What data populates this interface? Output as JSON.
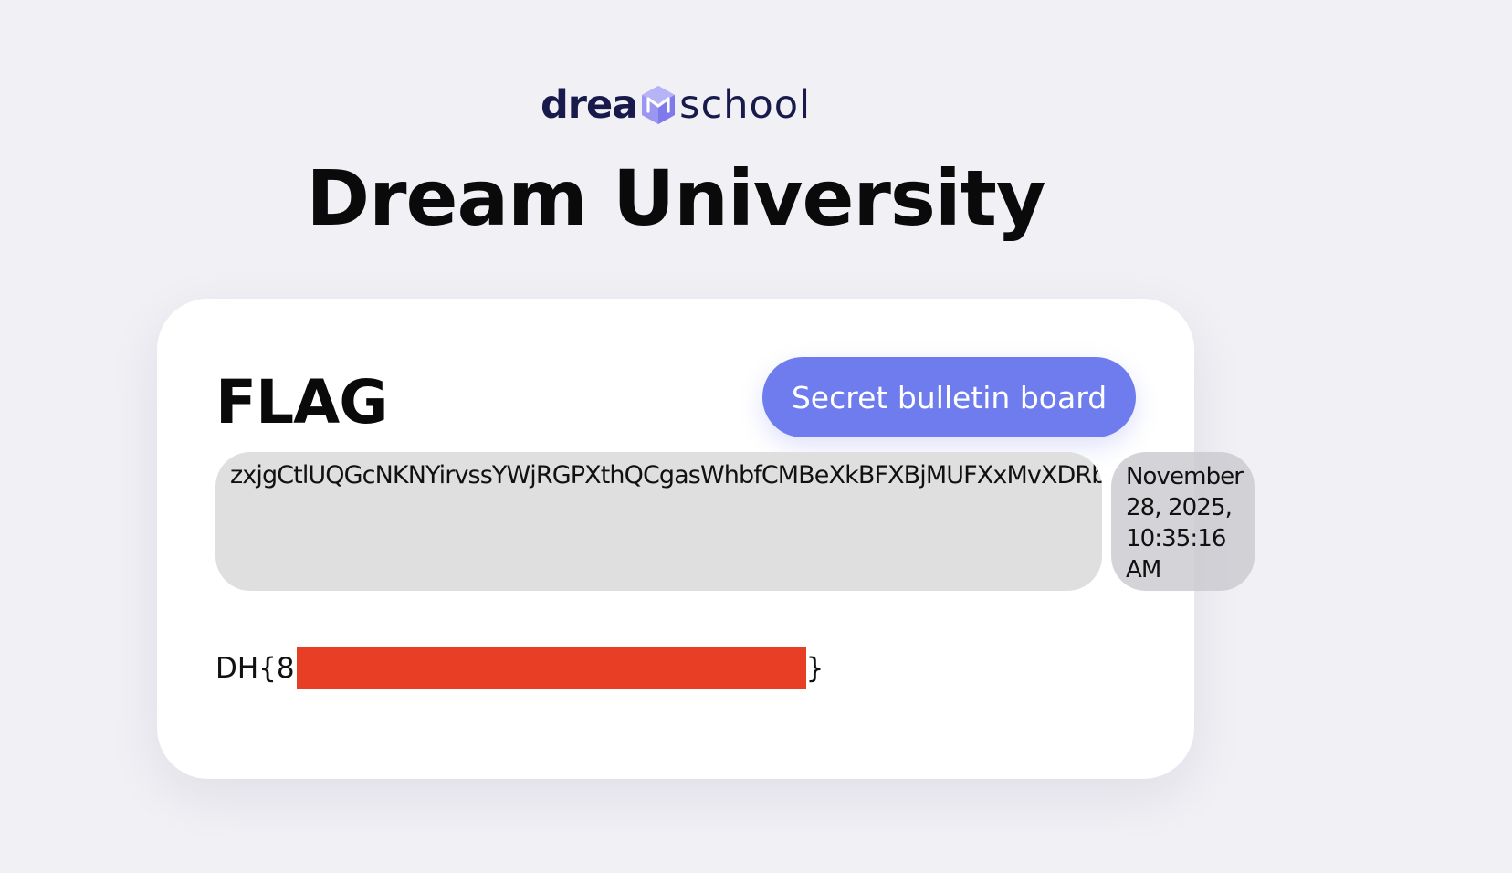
{
  "logo": {
    "text_start": "drea",
    "text_end": "school",
    "mark_icon": "dreamhack-cube-logo-icon",
    "colors": {
      "dark": "#171a4a",
      "mark": "#8a86ef"
    }
  },
  "page": {
    "title": "Dream University",
    "background": "#f1f0f5"
  },
  "card": {
    "heading": "FLAG",
    "secret_button_label": "Secret bulletin board",
    "accent_color": "#6e7cee",
    "post": {
      "content": "zxjgCtlUQGcNKNYirvssYWjRGPXthQCgasWhbfCMBeXkBFXBjMUFXxMvXDRbTmiJ",
      "date_lines": [
        "November",
        "28, 2025,",
        "10:35:16",
        "AM"
      ]
    },
    "flag": {
      "prefix": "DH{8",
      "suffix": "}",
      "redaction_color": "#e83e26"
    }
  }
}
